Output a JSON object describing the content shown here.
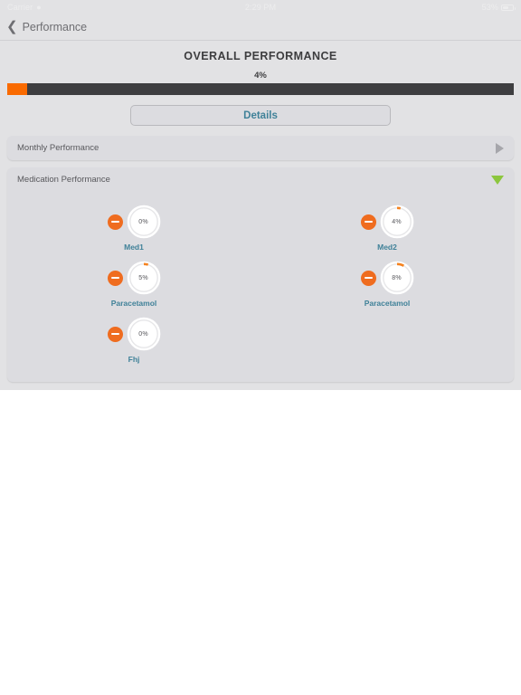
{
  "status_bar": {
    "carrier": "Carrier",
    "wifi_icon": "wifi-icon",
    "time": "2:29 PM",
    "battery_percent": "53%",
    "battery_icon": "battery-icon"
  },
  "nav_bar": {
    "back_icon": "chevron-left-icon",
    "back_label": "Performance"
  },
  "overall": {
    "title": "OVERALL PERFORMANCE",
    "percent_label": "4%",
    "progress_value": 4,
    "progress_fill_color": "#f96a00",
    "progress_track_color": "#3e3e40"
  },
  "details_button": {
    "label": "Details",
    "text_color": "#3f8198"
  },
  "panels": [
    {
      "title": "Monthly Performance",
      "expanded": false,
      "indicator_icon": "triangle-right-icon",
      "indicator_color": "#a6a6ab"
    },
    {
      "title": "Medication Performance",
      "expanded": true,
      "indicator_icon": "triangle-down-icon",
      "indicator_color": "#8cc63e"
    }
  ],
  "medications": [
    {
      "name": "Med1",
      "percent_label": "0%",
      "percent": 0,
      "remove_icon": "minus-circle-icon",
      "arc_color": "#f5821f"
    },
    {
      "name": "Med2",
      "percent_label": "4%",
      "percent": 4,
      "remove_icon": "minus-circle-icon",
      "arc_color": "#f5821f"
    },
    {
      "name": "Paracetamol",
      "percent_label": "5%",
      "percent": 5,
      "remove_icon": "minus-circle-icon",
      "arc_color": "#f5821f"
    },
    {
      "name": "Paracetamol",
      "percent_label": "8%",
      "percent": 8,
      "remove_icon": "minus-circle-icon",
      "arc_color": "#f5821f"
    },
    {
      "name": "Fhj",
      "percent_label": "0%",
      "percent": 0,
      "remove_icon": "minus-circle-icon",
      "arc_color": "#f5821f"
    }
  ]
}
